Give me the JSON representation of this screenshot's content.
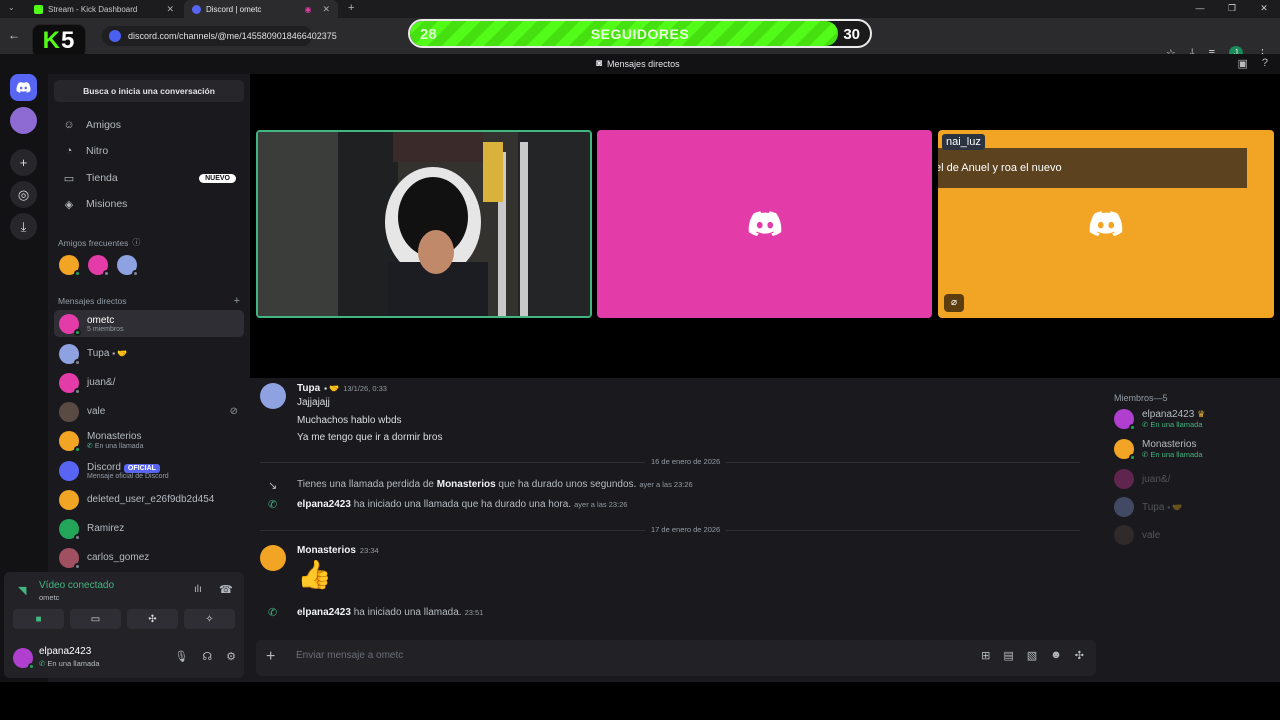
{
  "browser": {
    "tabs": [
      {
        "title": "Stream - Kick Dashboard",
        "favicon_color": "#53fc18"
      },
      {
        "title": "Discord | ometc",
        "favicon_color": "#5865f2"
      }
    ],
    "url": "discord.com/channels/@me/1455809018466402375",
    "profile_initial": "J"
  },
  "overlay": {
    "kick_badge_letter": "K",
    "kick_badge_number": "5",
    "followers_label": "SEGUIDORES",
    "followers_current": "28",
    "followers_goal": "30",
    "progress_fraction": 0.93,
    "accent": "#53fc18"
  },
  "topbar": {
    "title": "Mensajes directos"
  },
  "sidebar": {
    "search": "Busca o inicia una conversación",
    "nav": [
      {
        "label": "Amigos",
        "icon": "friends-icon"
      },
      {
        "label": "Nitro",
        "icon": "nitro-icon"
      },
      {
        "label": "Tienda",
        "icon": "shop-icon",
        "badge": "NUEVO"
      },
      {
        "label": "Misiones",
        "icon": "quests-icon"
      }
    ],
    "frequent_header": "Amigos frecuentes",
    "dm_header": "Mensajes directos",
    "dms": [
      {
        "name": "ometc",
        "sub": "5 miembros",
        "color": "#e33ba7"
      },
      {
        "name": "Tupa",
        "sub": "",
        "color": "#8ea1e1"
      },
      {
        "name": "juan&/",
        "sub": "",
        "color": "#e33ba7"
      },
      {
        "name": "vale",
        "sub": "",
        "color": "#5a4a44"
      },
      {
        "name": "Monasterios",
        "sub": "En una llamada",
        "color": "#f2a424"
      },
      {
        "name": "Discord",
        "sub": "Mensaje oficial de Discord",
        "color": "#5865f2",
        "tag": "OFICIAL"
      },
      {
        "name": "deleted_user_e26f9db2d454",
        "sub": "",
        "color": "#f2a424"
      },
      {
        "name": "Ramirez",
        "sub": "",
        "color": "#23a55a"
      },
      {
        "name": "carlos_gomez",
        "sub": "",
        "color": "#a05060"
      }
    ]
  },
  "voice": {
    "title": "Vídeo conectado",
    "channel": "ometc"
  },
  "user": {
    "name": "elpana2423",
    "status": "En una llamada"
  },
  "call": {
    "orange_name": "nai_luz",
    "orange_caption": "el de Anuel y roa el nuevo",
    "tile_colors": [
      "#2a2c2f",
      "#e33ba7",
      "#f2a424"
    ]
  },
  "chat": {
    "msg1": {
      "author": "Tupa",
      "time": "13/1/26, 0:33",
      "lines": [
        "Jajjajajj",
        "Muchachos hablo wbds",
        "Ya me tengo que ir a dormir bros"
      ]
    },
    "divider1": "16 de enero de 2026",
    "sys1": {
      "pre": "Tienes una llamada perdida de ",
      "name": "Monasterios",
      "post": " que ha durado unos segundos.",
      "time": "ayer a las 23:26"
    },
    "sys2": {
      "name": "elpana2423",
      "post": " ha iniciado una llamada que ha durado una hora.",
      "time": "ayer a las 23:26"
    },
    "divider2": "17 de enero de 2026",
    "msg2": {
      "author": "Monasterios",
      "time": "23:34",
      "emoji": "👍"
    },
    "sys3": {
      "name": "elpana2423",
      "post": " ha iniciado una llamada.",
      "time": "23:51"
    },
    "placeholder": "Enviar mensaje a ometc"
  },
  "members": {
    "header": "Miembros—5",
    "list": [
      {
        "name": "elpana2423",
        "sub": "En una llamada",
        "color": "#b03fd0",
        "dim": false
      },
      {
        "name": "Monasterios",
        "sub": "En una llamada",
        "color": "#f2a424",
        "dim": false
      },
      {
        "name": "juan&/",
        "sub": "",
        "color": "#e33ba7",
        "dim": true
      },
      {
        "name": "Tupa",
        "sub": "",
        "color": "#8ea1e1",
        "dim": true
      },
      {
        "name": "vale",
        "sub": "",
        "color": "#5a4a44",
        "dim": true
      }
    ]
  }
}
